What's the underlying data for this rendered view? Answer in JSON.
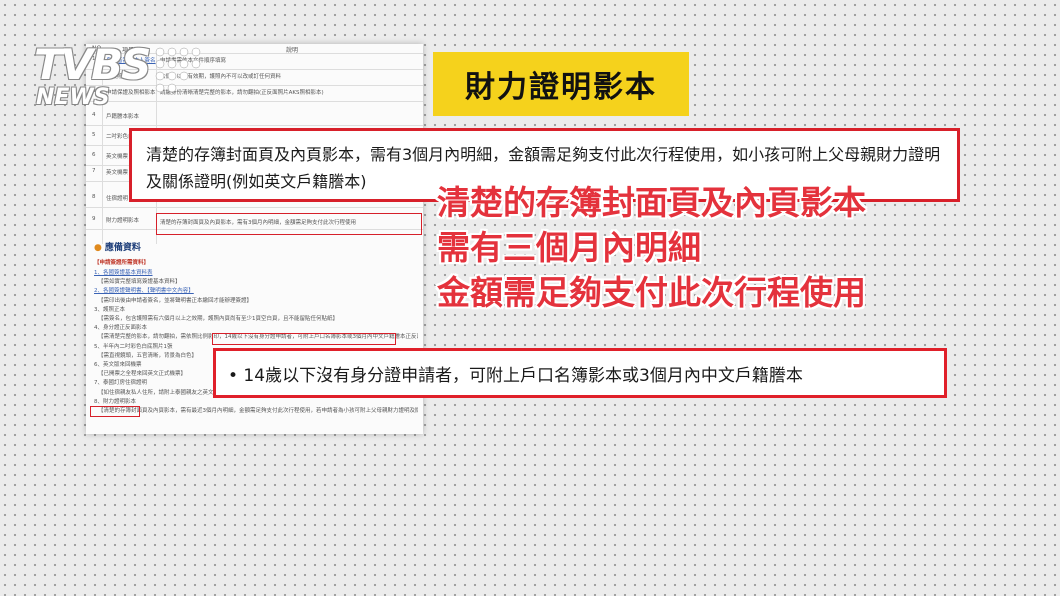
{
  "logo": {
    "main": "TVBS",
    "sub": "NEWS"
  },
  "title": "財力證明影本",
  "document": {
    "header_no": "NO",
    "header_item": "項目",
    "header_desc": "說明",
    "rows": [
      {
        "num": "1",
        "text": "身請者需經本人簽名",
        "desc": "申請書需依本文件順序填寫"
      },
      {
        "num": "2",
        "text": "原護照正本",
        "desc": "六個月以上有效期，護照內不可以改或訂任何資料"
      },
      {
        "num": "3",
        "text": "申請保證及照相影本",
        "desc": "請繳身份清晰清楚完整的影本，請勿翻拍(正反面照片AKS照相影本)"
      },
      {
        "num": "4",
        "text": "戶籍謄本影本",
        "desc": ""
      },
      {
        "num": "5",
        "text": "二吋彩色白底照片",
        "desc": ""
      },
      {
        "num": "6",
        "text": "英文機票",
        "desc": ""
      },
      {
        "num": "7",
        "text": "英文機票",
        "desc": ""
      },
      {
        "num": "8",
        "text": "住宿證明",
        "desc": "英文住宿證明，如住宿親友私人住所，請附上泰國親友之英文邀請函"
      },
      {
        "num": "9",
        "text": "財力證明影本",
        "desc": "清楚的存簿封面頁及內頁影本，需有3個月內明細，金額需足夠支付此次行程使用"
      }
    ],
    "section_title": "應備資料",
    "list_head": "【申請簽證所需資料】",
    "list_items": [
      "1、各國簽證基本資料表",
      "【需如實完整填寫簽證基本資料】",
      "2、各國簽證聲明書、【聲明書中文內容】",
      "【需印出後由申請者簽名，並將聲明書正本繳回才能辦理簽證】",
      "3、護照正本",
      "【需簽名，包含護照需有六個月以上之效期，護照內頁尚有至少1頁空白頁，且不能留貼任何貼紙】",
      "4、身分證正反面影本",
      "【需清楚完整的影本，請勿翻拍，需依照比例影印，14歲以下沒有身分證申請者，可附上戶口名簿影本或3個月內中文戶籍謄本正反面影本】",
      "5、半年內二吋彩色白底照片1張",
      "【需直視鏡頭，五官清晰，背景為白色】",
      "6、英文版來回機票",
      "【已開票之全程來回英文正式機票】",
      "7、泰國訂房住宿證明",
      "【如住宿親友私人住所，請附上泰國親友之英文邀請函】",
      "8、財力證明影本",
      "【清楚的存簿封面頁及內頁影本，需有最近3個月內明細，金額需足夠支付此次行程使用，若申請者為小孩可附上父母親財力證明及關係證明】"
    ]
  },
  "zoom_top": "清楚的存簿封面頁及內頁影本，需有3個月內明細，金額需足夠支付此次行程使用，如小孩可附上父母親財力證明及關係證明(例如英文戶籍謄本)",
  "caption": {
    "line1": "清楚的存簿封面頁及內頁影本",
    "line2": "需有三個月內明細",
    "line3": "金額需足夠支付此次行程使用"
  },
  "zoom_bottom": "• 14歲以下沒有身分證申請者，可附上戶口名簿影本或3個月內中文戶籍謄本",
  "colors": {
    "highlight_yellow": "#f5d21c",
    "emphasis_red": "#e4323c",
    "frame_red": "#d8202a"
  }
}
